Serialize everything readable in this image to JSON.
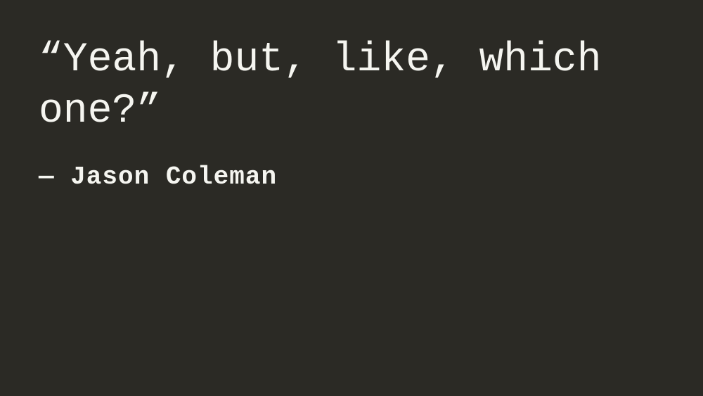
{
  "slide": {
    "quote": "“Yeah, but, like, which one?”",
    "attribution": "— Jason Coleman"
  }
}
